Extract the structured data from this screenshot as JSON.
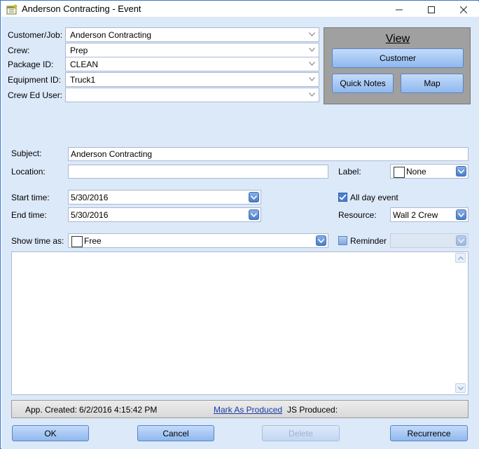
{
  "window": {
    "title": "Anderson Contracting - Event",
    "minimize": "–",
    "maximize": "☐",
    "close": "✕"
  },
  "job": {
    "customer_label": "Customer/Job:",
    "customer_value": "Anderson Contracting",
    "crew_label": "Crew:",
    "crew_value": "Prep",
    "package_label": "Package ID:",
    "package_value": "CLEAN",
    "equipment_label": "Equipment ID:",
    "equipment_value": "Truck1",
    "crew_ed_label": "Crew Ed User:",
    "crew_ed_value": ""
  },
  "view": {
    "title": "View",
    "customer_btn": "Customer",
    "quick_notes_btn": "Quick Notes",
    "map_btn": "Map"
  },
  "event": {
    "subject_label": "Subject:",
    "subject_value": "Anderson Contracting",
    "location_label": "Location:",
    "location_value": "",
    "label_label": "Label:",
    "label_value": "None",
    "start_label": "Start time:",
    "start_value": "5/30/2016",
    "end_label": "End time:",
    "end_value": "5/30/2016",
    "all_day_label": "All day event",
    "all_day_checked": true,
    "resource_label": "Resource:",
    "resource_value": "Wall 2 Crew",
    "show_time_label": "Show time as:",
    "show_time_value": "Free",
    "reminder_label": "Reminder",
    "reminder_checked": false,
    "notes": ""
  },
  "status": {
    "created_label": "App. Created:",
    "created_value": "6/2/2016 4:15:42 PM",
    "mark_produced": "Mark As Produced",
    "js_produced_label": "JS Produced:"
  },
  "buttons": {
    "ok": "OK",
    "cancel": "Cancel",
    "delete": "Delete",
    "recurrence": "Recurrence"
  },
  "colors": {
    "client_bg": "#dce9f9",
    "button_blue": "#a9c9f3",
    "view_panel": "#a0a0a0",
    "link": "#1a3aa8"
  }
}
